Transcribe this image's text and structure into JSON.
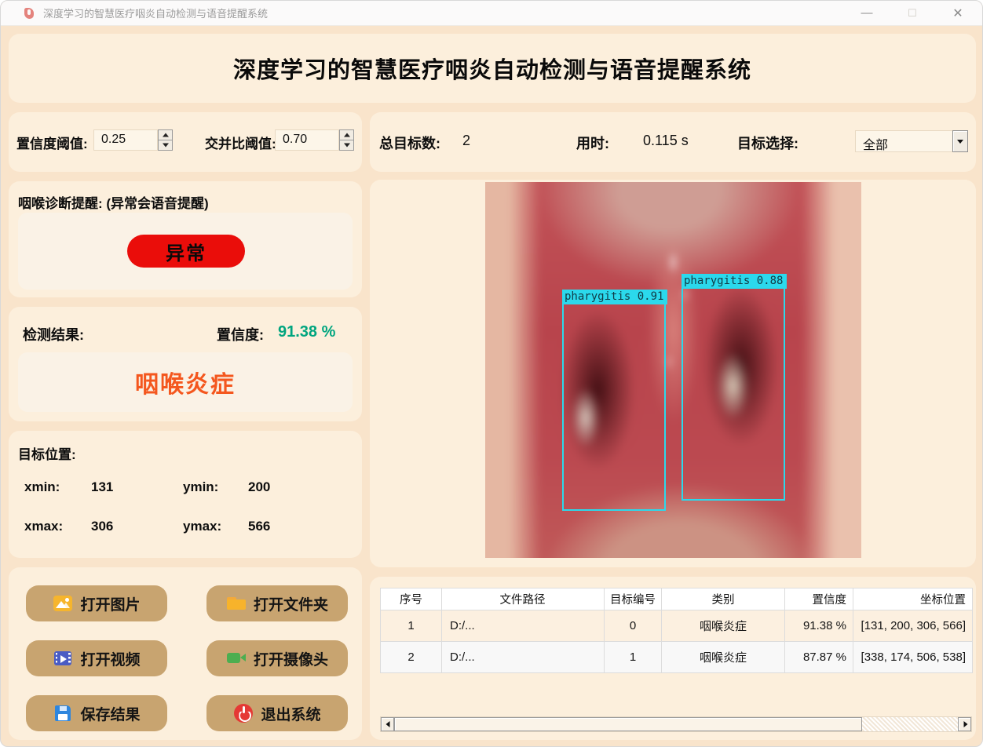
{
  "window": {
    "title": "深度学习的智慧医疗咽炎自动检测与语音提醒系统",
    "minimize": "—",
    "maximize": "☐",
    "close": "✕"
  },
  "banner": {
    "title": "深度学习的智慧医疗咽炎自动检测与语音提醒系统"
  },
  "thresholds": {
    "conf_label": "置信度阈值:",
    "conf_value": "0.25",
    "iou_label": "交并比阈值:",
    "iou_value": "0.70"
  },
  "info": {
    "total_label": "总目标数:",
    "total_value": "2",
    "time_label": "用时:",
    "time_value": "0.115 s",
    "select_label": "目标选择:",
    "select_value": "全部"
  },
  "diagnosis": {
    "label": "咽喉诊断提醒: (异常会语音提醒)",
    "status": "异常",
    "status_color": "#ea0d0a"
  },
  "result": {
    "label": "检测结果:",
    "conf_label": "置信度:",
    "conf_value": "91.38 %",
    "conf_color": "#00a57f",
    "disease": "咽喉炎症",
    "disease_color": "#f4571e"
  },
  "position": {
    "label": "目标位置:",
    "xmin_label": "xmin:",
    "xmin_value": "131",
    "ymin_label": "ymin:",
    "ymin_value": "200",
    "xmax_label": "xmax:",
    "xmax_value": "306",
    "ymax_label": "ymax:",
    "ymax_value": "566"
  },
  "buttons": [
    {
      "label": "打开图片",
      "icon": "image-icon"
    },
    {
      "label": "打开文件夹",
      "icon": "folder-icon"
    },
    {
      "label": "打开视频",
      "icon": "video-icon"
    },
    {
      "label": "打开摄像头",
      "icon": "camera-icon"
    },
    {
      "label": "保存结果",
      "icon": "save-icon"
    },
    {
      "label": "退出系统",
      "icon": "power-icon"
    }
  ],
  "detections": [
    {
      "label": "pharygitis 0.91",
      "box_color": "#2bd9ec"
    },
    {
      "label": "pharygitis 0.88",
      "box_color": "#2bd9ec"
    }
  ],
  "table": {
    "headers": [
      "序号",
      "文件路径",
      "目标编号",
      "类别",
      "置信度",
      "坐标位置"
    ],
    "rows": [
      [
        "1",
        "D:/...",
        "0",
        "咽喉炎症",
        "91.38 %",
        "[131, 200, 306, 566]"
      ],
      [
        "2",
        "D:/...",
        "1",
        "咽喉炎症",
        "87.87 %",
        "[338, 174, 506, 538]"
      ]
    ]
  },
  "colors": {
    "window_bg": "#f9e4cb",
    "panel_bg": "#fcefdc",
    "inner_bg": "#faf2e6",
    "button_tan": "#c8a470",
    "abnormal_red": "#ea0d0a",
    "confidence_green": "#00a57f",
    "disease_orange": "#f4571e",
    "detection_cyan": "#2bd9ec"
  }
}
